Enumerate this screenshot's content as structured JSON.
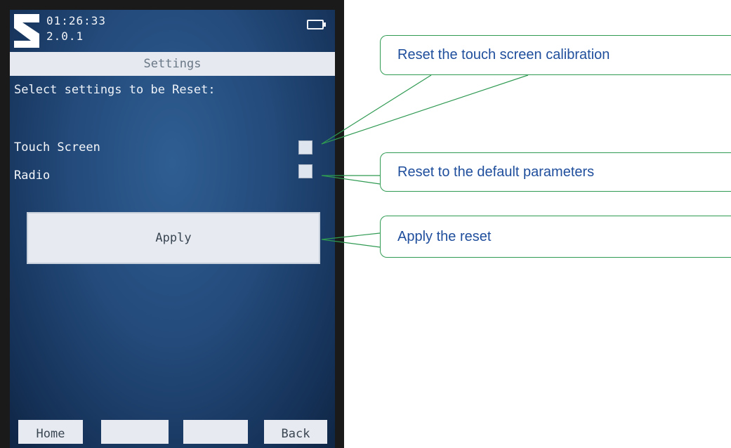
{
  "status": {
    "time": "01:26:33",
    "version": "2.0.1"
  },
  "header": {
    "title": "Settings"
  },
  "main": {
    "prompt": "Select settings to be Reset:",
    "options": [
      {
        "label": "Touch Screen",
        "checked": false
      },
      {
        "label": "Radio",
        "checked": false
      }
    ],
    "apply_label": "Apply"
  },
  "softkeys": {
    "home": "Home",
    "blank1": "",
    "blank2": "",
    "back": "Back"
  },
  "callouts": {
    "touch_screen": "Reset the touch screen calibration",
    "radio": "Reset to the default parameters",
    "apply": "Apply the reset"
  },
  "icons": {
    "logo": "brand-s-logo-icon",
    "battery": "battery-icon"
  },
  "colors": {
    "screen": "#234a7a",
    "callout_border": "#2f9a52",
    "callout_text": "#1f4e9c"
  }
}
